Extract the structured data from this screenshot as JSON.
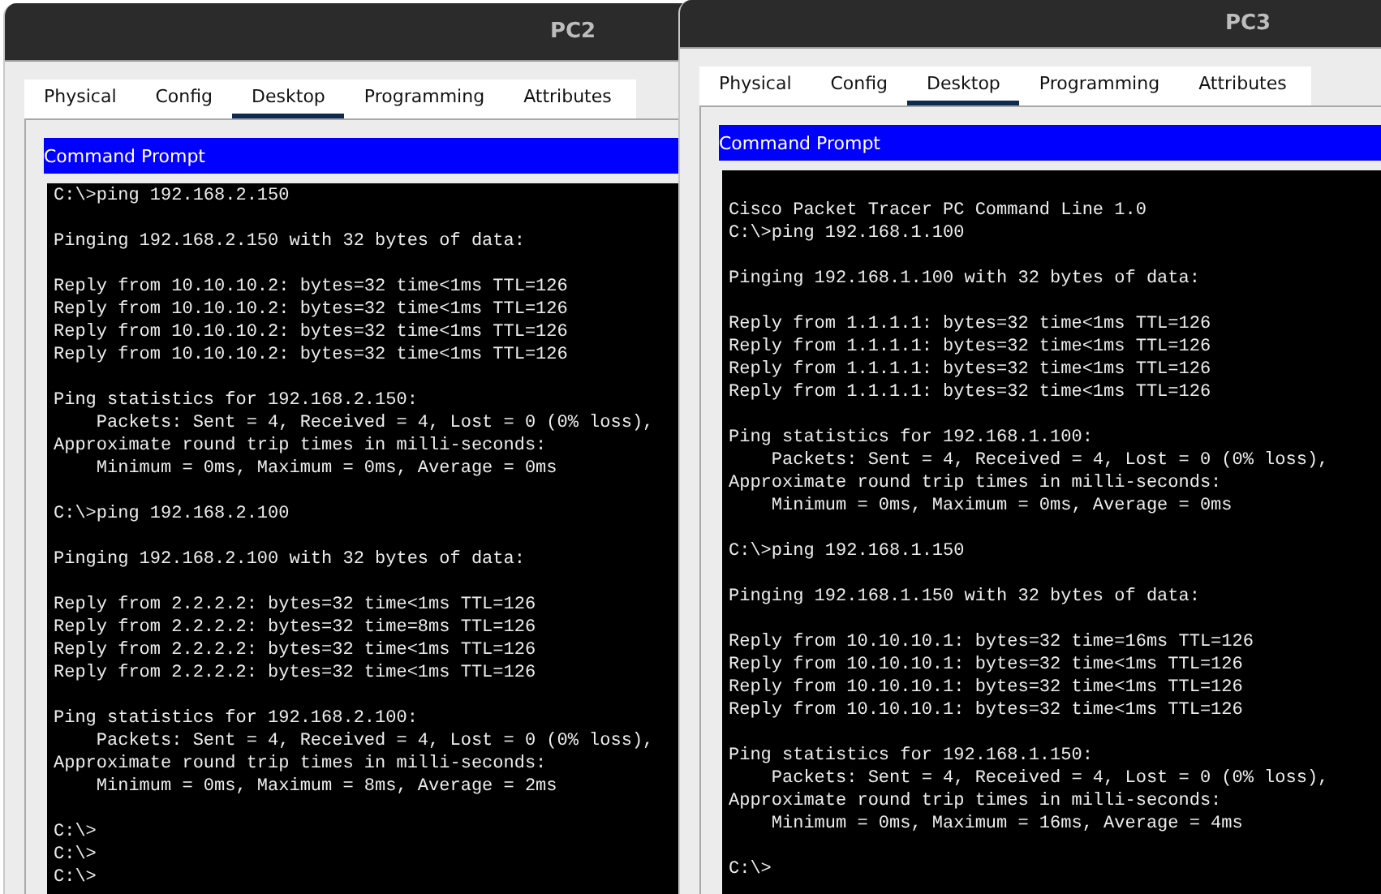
{
  "windows": [
    {
      "title": "PC2",
      "tabs": [
        {
          "label": "Physical",
          "selected": false
        },
        {
          "label": "Config",
          "selected": false
        },
        {
          "label": "Desktop",
          "selected": true
        },
        {
          "label": "Programming",
          "selected": false
        },
        {
          "label": "Attributes",
          "selected": false
        }
      ],
      "panel_title": "Command Prompt",
      "terminal_blocks": [
        [
          "C:\\>ping 192.168.2.150"
        ],
        [
          "Pinging 192.168.2.150 with 32 bytes of data:"
        ],
        [
          "Reply from 10.10.10.2: bytes=32 time<1ms TTL=126",
          "Reply from 10.10.10.2: bytes=32 time<1ms TTL=126",
          "Reply from 10.10.10.2: bytes=32 time<1ms TTL=126",
          "Reply from 10.10.10.2: bytes=32 time<1ms TTL=126"
        ],
        [
          "Ping statistics for 192.168.2.150:",
          "    Packets: Sent = 4, Received = 4, Lost = 0 (0% loss),",
          "Approximate round trip times in milli-seconds:",
          "    Minimum = 0ms, Maximum = 0ms, Average = 0ms"
        ],
        [
          "C:\\>ping 192.168.2.100"
        ],
        [
          "Pinging 192.168.2.100 with 32 bytes of data:"
        ],
        [
          "Reply from 2.2.2.2: bytes=32 time<1ms TTL=126",
          "Reply from 2.2.2.2: bytes=32 time=8ms TTL=126",
          "Reply from 2.2.2.2: bytes=32 time<1ms TTL=126",
          "Reply from 2.2.2.2: bytes=32 time<1ms TTL=126"
        ],
        [
          "Ping statistics for 192.168.2.100:",
          "    Packets: Sent = 4, Received = 4, Lost = 0 (0% loss),",
          "Approximate round trip times in milli-seconds:",
          "    Minimum = 0ms, Maximum = 8ms, Average = 2ms"
        ],
        [
          "C:\\>",
          "C:\\>",
          "C:\\>"
        ]
      ]
    },
    {
      "title": "PC3",
      "tabs": [
        {
          "label": "Physical",
          "selected": false
        },
        {
          "label": "Config",
          "selected": false
        },
        {
          "label": "Desktop",
          "selected": true
        },
        {
          "label": "Programming",
          "selected": false
        },
        {
          "label": "Attributes",
          "selected": false
        }
      ],
      "panel_title": "Command Prompt",
      "terminal_blocks": [
        [
          "Cisco Packet Tracer PC Command Line 1.0",
          "C:\\>ping 192.168.1.100"
        ],
        [
          "Pinging 192.168.1.100 with 32 bytes of data:"
        ],
        [
          "Reply from 1.1.1.1: bytes=32 time<1ms TTL=126",
          "Reply from 1.1.1.1: bytes=32 time<1ms TTL=126",
          "Reply from 1.1.1.1: bytes=32 time<1ms TTL=126",
          "Reply from 1.1.1.1: bytes=32 time<1ms TTL=126"
        ],
        [
          "Ping statistics for 192.168.1.100:",
          "    Packets: Sent = 4, Received = 4, Lost = 0 (0% loss),",
          "Approximate round trip times in milli-seconds:",
          "    Minimum = 0ms, Maximum = 0ms, Average = 0ms"
        ],
        [
          "C:\\>ping 192.168.1.150"
        ],
        [
          "Pinging 192.168.1.150 with 32 bytes of data:"
        ],
        [
          "Reply from 10.10.10.1: bytes=32 time=16ms TTL=126",
          "Reply from 10.10.10.1: bytes=32 time<1ms TTL=126",
          "Reply from 10.10.10.1: bytes=32 time<1ms TTL=126",
          "Reply from 10.10.10.1: bytes=32 time<1ms TTL=126"
        ],
        [
          "Ping statistics for 192.168.1.150:",
          "    Packets: Sent = 4, Received = 4, Lost = 0 (0% loss),",
          "Approximate round trip times in milli-seconds:",
          "    Minimum = 0ms, Maximum = 16ms, Average = 4ms"
        ],
        [
          "C:\\>"
        ]
      ]
    }
  ]
}
